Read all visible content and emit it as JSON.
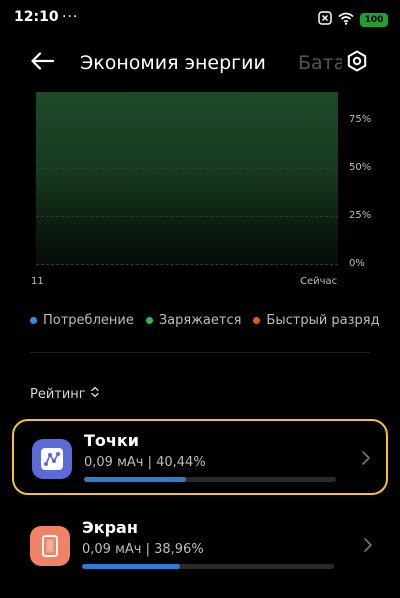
{
  "status_bar": {
    "time": "12:10",
    "dots": "···",
    "battery_level": "100",
    "icons": [
      "sim-off-icon",
      "wifi-icon",
      "battery-icon"
    ]
  },
  "header": {
    "title": "Экономия энергии",
    "tab_next": "Бата",
    "icons": [
      "back-arrow-icon",
      "settings-icon"
    ]
  },
  "chart_data": {
    "type": "area",
    "x_labels": [
      "11",
      "Сейчас"
    ],
    "y_ticks": [
      "75%",
      "50%",
      "25%",
      "0%"
    ],
    "ylim": [
      0,
      100
    ],
    "legend_placement": "bottom",
    "series": [
      {
        "name": "Потребление",
        "color": "#2d8ff0"
      },
      {
        "name": "Заряжается",
        "color": "#27c24c"
      },
      {
        "name": "Быстрый разряд",
        "color": "#f4511e"
      }
    ]
  },
  "sort": {
    "label": "Рейтинг",
    "icon": "sort-updown-icon"
  },
  "apps": [
    {
      "name": "Точки",
      "stats": "0,09 мАч | 40,44%",
      "share": 0.4044,
      "icon": "dots-graph-icon",
      "icon_color": "#5b6bd6",
      "highlighted": true
    },
    {
      "name": "Экран",
      "stats": "0,09 мАч | 38,96%",
      "share": 0.3896,
      "icon": "screen-icon",
      "icon_color": "#f28265",
      "highlighted": false
    }
  ],
  "colors": {
    "highlight_border": "#f4c430",
    "progress": "#2a7fd2",
    "chart_fill": "#1d4a27"
  }
}
